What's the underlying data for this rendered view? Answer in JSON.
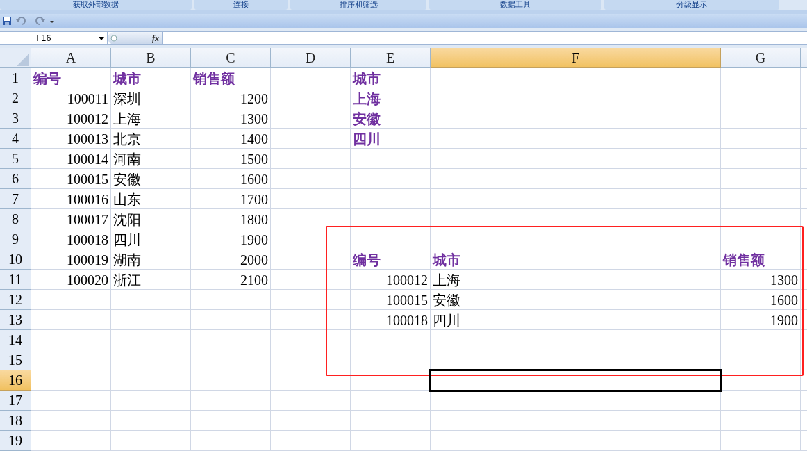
{
  "ribbon_groups": [
    "获取外部数据",
    "连接",
    "排序和筛选",
    "数据工具",
    "分级显示"
  ],
  "name_box": "F16",
  "formula_label": "fx",
  "columns": [
    {
      "label": "A",
      "selected": false
    },
    {
      "label": "B",
      "selected": false
    },
    {
      "label": "C",
      "selected": false
    },
    {
      "label": "D",
      "selected": false
    },
    {
      "label": "E",
      "selected": false
    },
    {
      "label": "F",
      "selected": true
    },
    {
      "label": "G",
      "selected": false
    }
  ],
  "rows": [
    {
      "label": "1",
      "selected": false,
      "cells": [
        {
          "kind": "header",
          "text": "编号"
        },
        {
          "kind": "header",
          "text": "城市"
        },
        {
          "kind": "header",
          "text": "销售额"
        },
        null,
        {
          "kind": "header",
          "text": "城市"
        },
        null,
        null
      ]
    },
    {
      "label": "2",
      "selected": false,
      "cells": [
        {
          "kind": "number",
          "text": "100011"
        },
        {
          "kind": "text",
          "text": "深圳"
        },
        {
          "kind": "number",
          "text": "1200"
        },
        null,
        {
          "kind": "header",
          "text": "上海"
        },
        null,
        null
      ]
    },
    {
      "label": "3",
      "selected": false,
      "cells": [
        {
          "kind": "number",
          "text": "100012"
        },
        {
          "kind": "text",
          "text": "上海"
        },
        {
          "kind": "number",
          "text": "1300"
        },
        null,
        {
          "kind": "header",
          "text": "安徽"
        },
        null,
        null
      ]
    },
    {
      "label": "4",
      "selected": false,
      "cells": [
        {
          "kind": "number",
          "text": "100013"
        },
        {
          "kind": "text",
          "text": "北京"
        },
        {
          "kind": "number",
          "text": "1400"
        },
        null,
        {
          "kind": "header",
          "text": "四川"
        },
        null,
        null
      ]
    },
    {
      "label": "5",
      "selected": false,
      "cells": [
        {
          "kind": "number",
          "text": "100014"
        },
        {
          "kind": "text",
          "text": "河南"
        },
        {
          "kind": "number",
          "text": "1500"
        },
        null,
        null,
        null,
        null
      ]
    },
    {
      "label": "6",
      "selected": false,
      "cells": [
        {
          "kind": "number",
          "text": "100015"
        },
        {
          "kind": "text",
          "text": "安徽"
        },
        {
          "kind": "number",
          "text": "1600"
        },
        null,
        null,
        null,
        null
      ]
    },
    {
      "label": "7",
      "selected": false,
      "cells": [
        {
          "kind": "number",
          "text": "100016"
        },
        {
          "kind": "text",
          "text": "山东"
        },
        {
          "kind": "number",
          "text": "1700"
        },
        null,
        null,
        null,
        null
      ]
    },
    {
      "label": "8",
      "selected": false,
      "cells": [
        {
          "kind": "number",
          "text": "100017"
        },
        {
          "kind": "text",
          "text": "沈阳"
        },
        {
          "kind": "number",
          "text": "1800"
        },
        null,
        null,
        null,
        null
      ]
    },
    {
      "label": "9",
      "selected": false,
      "cells": [
        {
          "kind": "number",
          "text": "100018"
        },
        {
          "kind": "text",
          "text": "四川"
        },
        {
          "kind": "number",
          "text": "1900"
        },
        null,
        null,
        null,
        null
      ]
    },
    {
      "label": "10",
      "selected": false,
      "cells": [
        {
          "kind": "number",
          "text": "100019"
        },
        {
          "kind": "text",
          "text": "湖南"
        },
        {
          "kind": "number",
          "text": "2000"
        },
        null,
        {
          "kind": "header",
          "text": "编号"
        },
        {
          "kind": "header",
          "text": "城市"
        },
        {
          "kind": "header",
          "text": "销售额"
        }
      ]
    },
    {
      "label": "11",
      "selected": false,
      "cells": [
        {
          "kind": "number",
          "text": "100020"
        },
        {
          "kind": "text",
          "text": "浙江"
        },
        {
          "kind": "number",
          "text": "2100"
        },
        null,
        {
          "kind": "number",
          "text": "100012"
        },
        {
          "kind": "text",
          "text": "上海"
        },
        {
          "kind": "number",
          "text": "1300"
        }
      ]
    },
    {
      "label": "12",
      "selected": false,
      "cells": [
        null,
        null,
        null,
        null,
        {
          "kind": "number",
          "text": "100015"
        },
        {
          "kind": "text",
          "text": "安徽"
        },
        {
          "kind": "number",
          "text": "1600"
        }
      ]
    },
    {
      "label": "13",
      "selected": false,
      "cells": [
        null,
        null,
        null,
        null,
        {
          "kind": "number",
          "text": "100018"
        },
        {
          "kind": "text",
          "text": "四川"
        },
        {
          "kind": "number",
          "text": "1900"
        }
      ]
    },
    {
      "label": "14",
      "selected": false,
      "cells": [
        null,
        null,
        null,
        null,
        null,
        null,
        null
      ]
    },
    {
      "label": "15",
      "selected": false,
      "cells": [
        null,
        null,
        null,
        null,
        null,
        null,
        null
      ]
    },
    {
      "label": "16",
      "selected": true,
      "cells": [
        null,
        null,
        null,
        null,
        null,
        null,
        null
      ]
    },
    {
      "label": "17",
      "selected": false,
      "cells": [
        null,
        null,
        null,
        null,
        null,
        null,
        null
      ]
    },
    {
      "label": "18",
      "selected": false,
      "cells": [
        null,
        null,
        null,
        null,
        null,
        null,
        null
      ]
    },
    {
      "label": "19",
      "selected": false,
      "cells": [
        null,
        null,
        null,
        null,
        null,
        null,
        null
      ]
    }
  ]
}
